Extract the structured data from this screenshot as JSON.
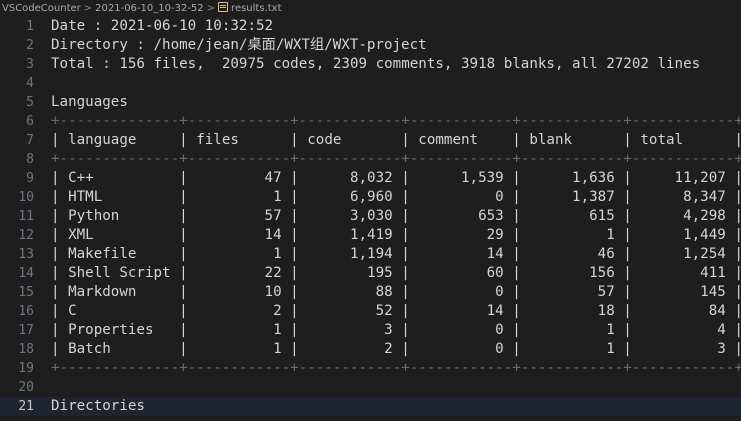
{
  "breadcrumb": {
    "items": [
      "VSCodeCounter",
      "2021-06-10_10-32-52",
      "results.txt"
    ],
    "separator": ">"
  },
  "editor": {
    "lines": [
      {
        "num": "1",
        "text": "Date : 2021-06-10 10:32:52"
      },
      {
        "num": "2",
        "text": "Directory : /home/jean/桌面/WXT组/WXT-project"
      },
      {
        "num": "3",
        "text": "Total : 156 files,  20975 codes, 2309 comments, 3918 blanks, all 27202 lines"
      },
      {
        "num": "4",
        "text": ""
      },
      {
        "num": "5",
        "text": "Languages"
      },
      {
        "num": "6",
        "text": "+--------------+------------+------------+------------+------------+------------+"
      },
      {
        "num": "7",
        "text": "| language     | files      | code       | comment    | blank      | total      |"
      },
      {
        "num": "8",
        "text": "+--------------+------------+------------+------------+------------+------------+"
      },
      {
        "num": "9",
        "text": "| C++          |         47 |      8,032 |      1,539 |      1,636 |     11,207 |"
      },
      {
        "num": "10",
        "text": "| HTML         |          1 |      6,960 |          0 |      1,387 |      8,347 |"
      },
      {
        "num": "11",
        "text": "| Python       |         57 |      3,030 |        653 |        615 |      4,298 |"
      },
      {
        "num": "12",
        "text": "| XML          |         14 |      1,419 |         29 |          1 |      1,449 |"
      },
      {
        "num": "13",
        "text": "| Makefile     |          1 |      1,194 |         14 |         46 |      1,254 |"
      },
      {
        "num": "14",
        "text": "| Shell Script |         22 |        195 |         60 |        156 |        411 |"
      },
      {
        "num": "15",
        "text": "| Markdown     |         10 |         88 |          0 |         57 |        145 |"
      },
      {
        "num": "16",
        "text": "| C            |          2 |         52 |         14 |         18 |         84 |"
      },
      {
        "num": "17",
        "text": "| Properties   |          1 |          3 |          0 |          1 |          4 |"
      },
      {
        "num": "18",
        "text": "| Batch        |          1 |          2 |          0 |          1 |          3 |"
      },
      {
        "num": "19",
        "text": "+--------------+------------+------------+------------+------------+------------+"
      },
      {
        "num": "20",
        "text": ""
      },
      {
        "num": "21",
        "text": "Directories"
      }
    ],
    "current_line": "21"
  }
}
